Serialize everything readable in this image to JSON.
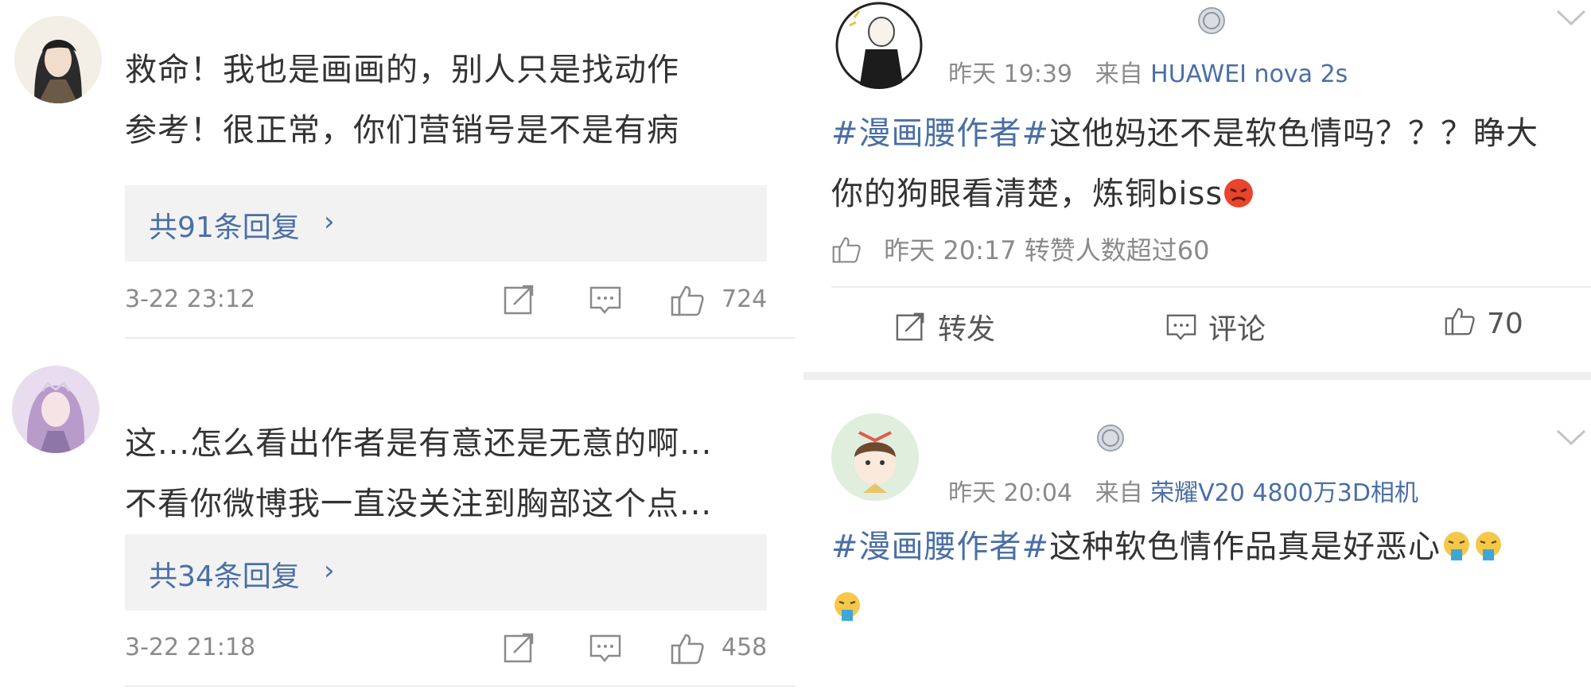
{
  "left_comments": [
    {
      "line1": "救命！我也是画画的，别人只是找动作",
      "line2": "参考！很正常，你们营销号是不是有病",
      "reply_label": "共91条回复",
      "chevron": "›",
      "date": "3-22 23:12",
      "likes": "724"
    },
    {
      "line1": "这...怎么看出作者是有意还是无意的啊...",
      "line2": "不看你微博我一直没关注到胸部这个点...",
      "reply_label": "共34条回复",
      "chevron": "›",
      "date": "3-22 21:18",
      "likes": "458"
    }
  ],
  "right_posts": [
    {
      "time": "昨天 19:39",
      "from_label": "来自",
      "device": "HUAWEI nova 2s",
      "hashtag": "#漫画腰作者#",
      "body_line1_rest": "这他妈还不是软色情吗？？？睁大",
      "body_line2": "你的狗眼看清楚，炼铜biss",
      "like_row": "昨天 20:17 转赞人数超过60",
      "actions": {
        "repost": "转发",
        "comment": "评论",
        "likes": "70"
      }
    },
    {
      "time": "昨天 20:04",
      "from_label": "来自",
      "device": "荣耀V20 4800万3D相机",
      "hashtag": "#漫画腰作者#",
      "body_line1_rest": "这种软色情作品真是好恶心"
    }
  ],
  "icons": {
    "share": "share-icon",
    "comment": "comment-icon",
    "like": "thumb-up-icon",
    "medal": "medal-icon",
    "chevron": "chevron-down-icon"
  },
  "colors": {
    "link_blue": "#4a6fa5",
    "meta_grey": "#8a8a8a",
    "reply_bg": "#f2f2f2"
  }
}
